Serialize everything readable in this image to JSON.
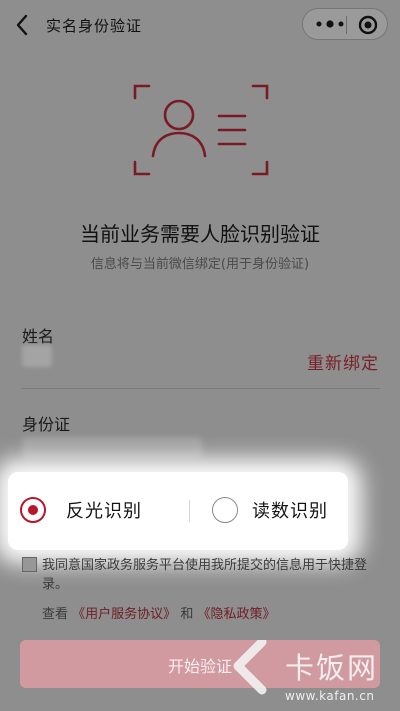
{
  "header": {
    "title": "实名身份验证"
  },
  "hero": {
    "headline": "当前业务需要人脸识别验证",
    "subline": "信息将与当前微信绑定(用于身份验证)"
  },
  "form": {
    "name_label": "姓名",
    "rebind_label": "重新绑定",
    "id_label": "身份证"
  },
  "options": {
    "items": [
      {
        "label": "反光识别",
        "selected": true
      },
      {
        "label": "读数识别",
        "selected": false
      }
    ]
  },
  "agreement": {
    "text": "我同意国家政务服务平台使用我所提交的信息用于快捷登录。",
    "prefix": "查看",
    "link1": "《用户服务协议》",
    "conj": "和",
    "link2": "《隐私政策》"
  },
  "start_button": {
    "label": "开始验证"
  },
  "watermark": {
    "text": "卡饭网",
    "url": "www.kafan.cn"
  },
  "colors": {
    "accent": "#b5182a",
    "rebind": "#7a1f28",
    "button_bg": "#d19aa1"
  }
}
